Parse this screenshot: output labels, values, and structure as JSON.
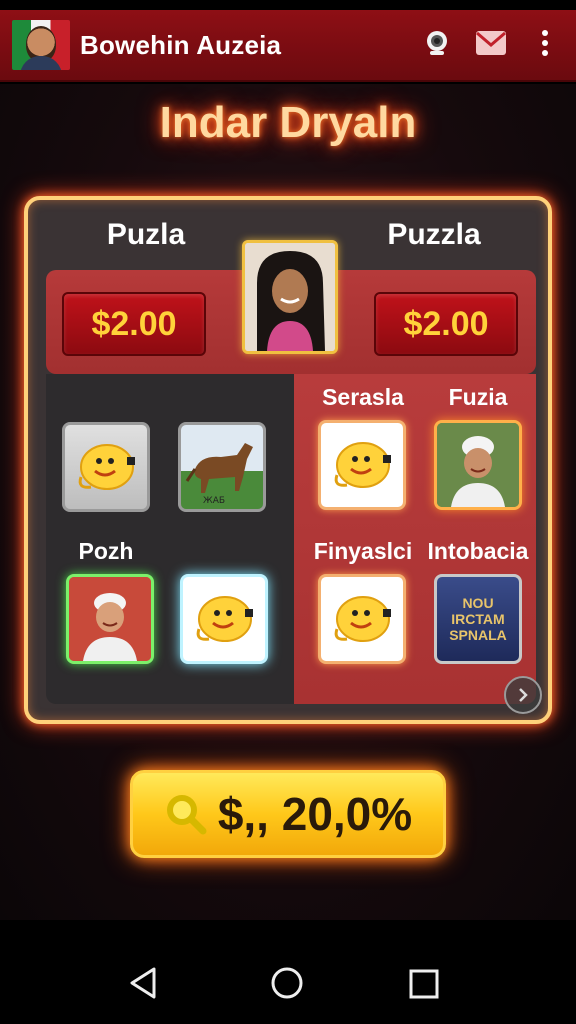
{
  "app": {
    "title": "Bowehin Auzeia"
  },
  "game": {
    "title": "Indar Dryaln",
    "players": [
      {
        "label": "Puzla",
        "price": "$2.00"
      },
      {
        "label": "Puzzla",
        "price": "$2.00"
      }
    ],
    "right_labels": {
      "top_left": "Serasla",
      "top_right": "Fuzia",
      "bottom_left": "Finyaslci",
      "bottom_right": "Intobacia"
    },
    "left_labels": {
      "bottom_left": "Pozh"
    },
    "poster_text": "NOU IRCTAM SPNALA",
    "horse_caption": "ЖАБ",
    "bet_label": "$,, 20,0%"
  },
  "colors": {
    "app_bar": "#8e0f15",
    "accent_gold": "#ffd23a",
    "board_border": "#ffd17a",
    "bet_button": "#ffc81a"
  },
  "icons": {
    "camera": "camera-icon",
    "mail": "mail-icon",
    "more": "more-vertical-icon",
    "search": "search-icon",
    "next": "chevron-right-icon",
    "nav_back": "nav-back-icon",
    "nav_home": "nav-home-icon",
    "nav_recents": "nav-recents-icon"
  }
}
